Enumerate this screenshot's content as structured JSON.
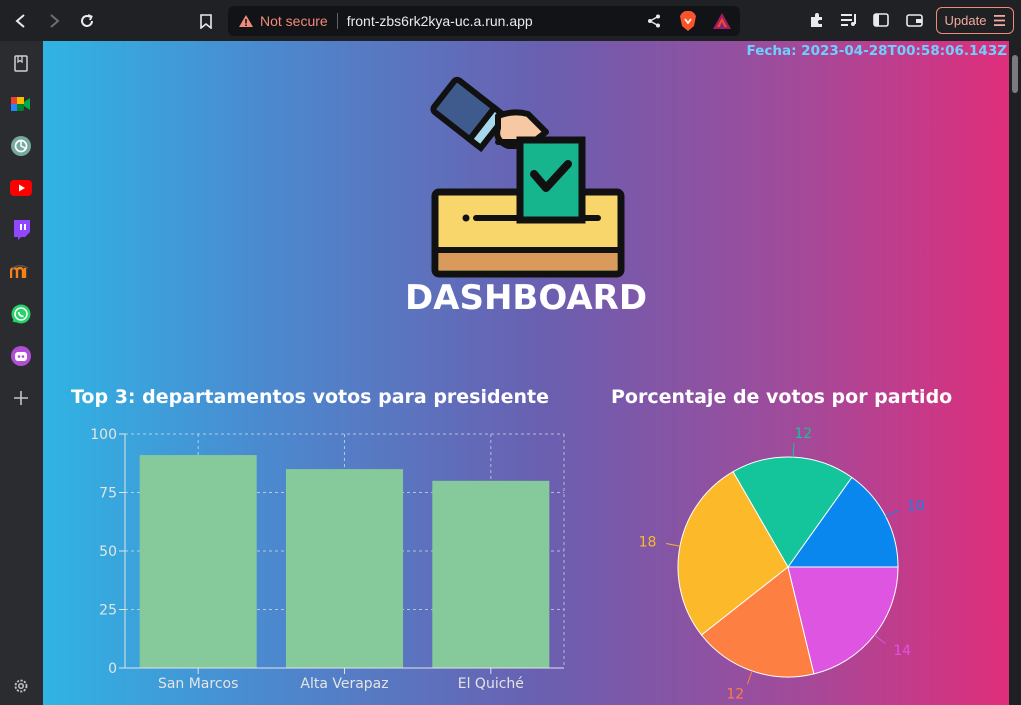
{
  "browser": {
    "url_warning": "Not secure",
    "url": "front-zbs6rk2kya-uc.a.run.app",
    "update_label": "Update"
  },
  "page": {
    "fecha": "Fecha: 2023-04-28T00:58:06.143Z",
    "title": "DASHBOARD",
    "bar_title": "Top 3: departamentos votos para presidente",
    "pie_title": "Porcentaje de votos por partido"
  },
  "sidebar": {
    "items": [
      "bookmarks-icon",
      "google-meet-icon",
      "chatgpt-icon",
      "youtube-icon",
      "twitch-icon",
      "moodle-icon",
      "whatsapp-icon",
      "assistant-bot-icon",
      "add-icon",
      "settings-icon"
    ]
  },
  "colors": {
    "bar_fill": "#86c99b",
    "pie": [
      "#0a87ef",
      "#14c49a",
      "#fcb929",
      "#fd7f41",
      "#dd55e1"
    ]
  },
  "chart_data": [
    {
      "type": "bar",
      "title": "Top 3: departamentos votos para presidente",
      "categories": [
        "San Marcos",
        "Alta Verapaz",
        "El Quiché"
      ],
      "values": [
        91,
        85,
        80
      ],
      "ylim": [
        0,
        100
      ],
      "yticks": [
        0,
        25,
        50,
        75,
        100
      ],
      "grid": true,
      "xlabel": "",
      "ylabel": ""
    },
    {
      "type": "pie",
      "title": "Porcentaje de votos por partido",
      "values": [
        10,
        12,
        18,
        12,
        14
      ],
      "slice_order": "counterclockwise from 3 o'clock"
    }
  ]
}
